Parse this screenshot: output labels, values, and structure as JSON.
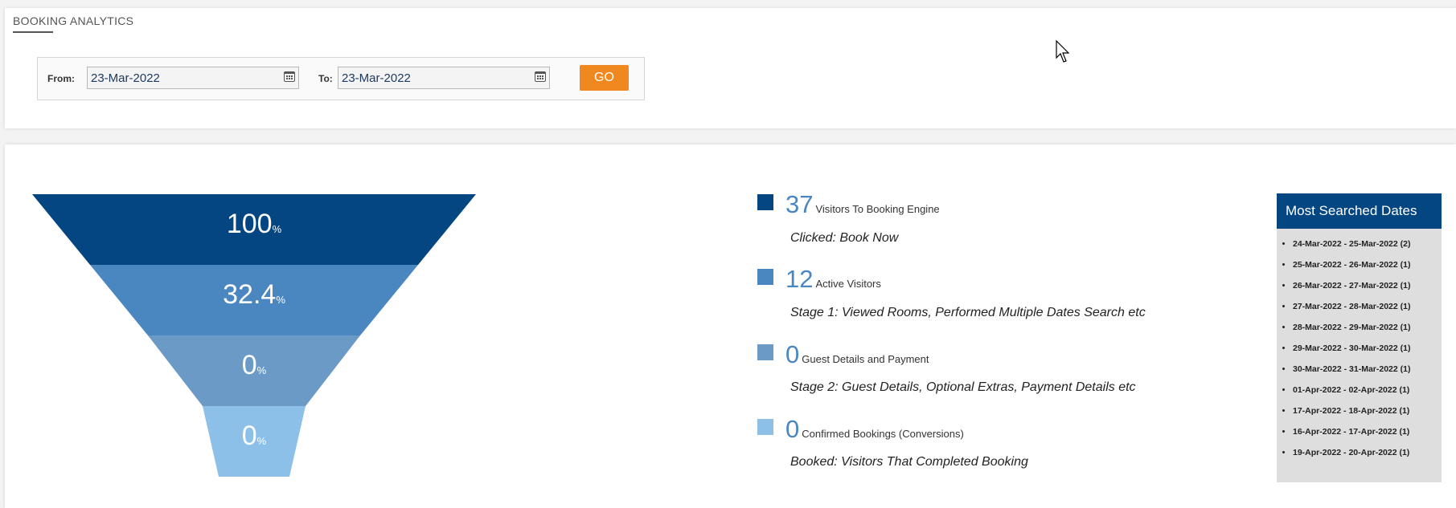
{
  "header": {
    "title": "BOOKING ANALYTICS"
  },
  "filters": {
    "from_label": "From:",
    "from_value": "23-Mar-2022",
    "to_label": "To:",
    "to_value": "23-Mar-2022",
    "go_label": "GO"
  },
  "funnel": {
    "stages": [
      {
        "percent": "100",
        "unit": "%",
        "color": "#034682"
      },
      {
        "percent": "32.4",
        "unit": "%",
        "color": "#4a86c0"
      },
      {
        "percent": "0",
        "unit": "%",
        "color": "#6b9ac7"
      },
      {
        "percent": "0",
        "unit": "%",
        "color": "#8cc0e8"
      }
    ]
  },
  "legend": [
    {
      "count": "37",
      "name": "Visitors To Booking Engine",
      "desc": "Clicked: Book Now",
      "color": "#034682"
    },
    {
      "count": "12",
      "name": "Active Visitors",
      "desc": "Stage 1: Viewed Rooms, Performed Multiple Dates Search etc",
      "color": "#4a86c0"
    },
    {
      "count": "0",
      "name": "Guest Details and Payment",
      "desc": "Stage 2: Guest Details, Optional Extras, Payment Details etc",
      "color": "#6b9ac7"
    },
    {
      "count": "0",
      "name": "Confirmed Bookings (Conversions)",
      "desc": "Booked: Visitors That Completed Booking",
      "color": "#8cc0e8"
    }
  ],
  "most_searched": {
    "title": "Most Searched Dates",
    "items": [
      "24-Mar-2022 - 25-Mar-2022 (2)",
      "25-Mar-2022 - 26-Mar-2022 (1)",
      "26-Mar-2022 - 27-Mar-2022 (1)",
      "27-Mar-2022 - 28-Mar-2022 (1)",
      "28-Mar-2022 - 29-Mar-2022 (1)",
      "29-Mar-2022 - 30-Mar-2022 (1)",
      "30-Mar-2022 - 31-Mar-2022 (1)",
      "01-Apr-2022 - 02-Apr-2022 (1)",
      "17-Apr-2022 - 18-Apr-2022 (1)",
      "16-Apr-2022 - 17-Apr-2022 (1)",
      "19-Apr-2022 - 20-Apr-2022 (1)"
    ]
  }
}
